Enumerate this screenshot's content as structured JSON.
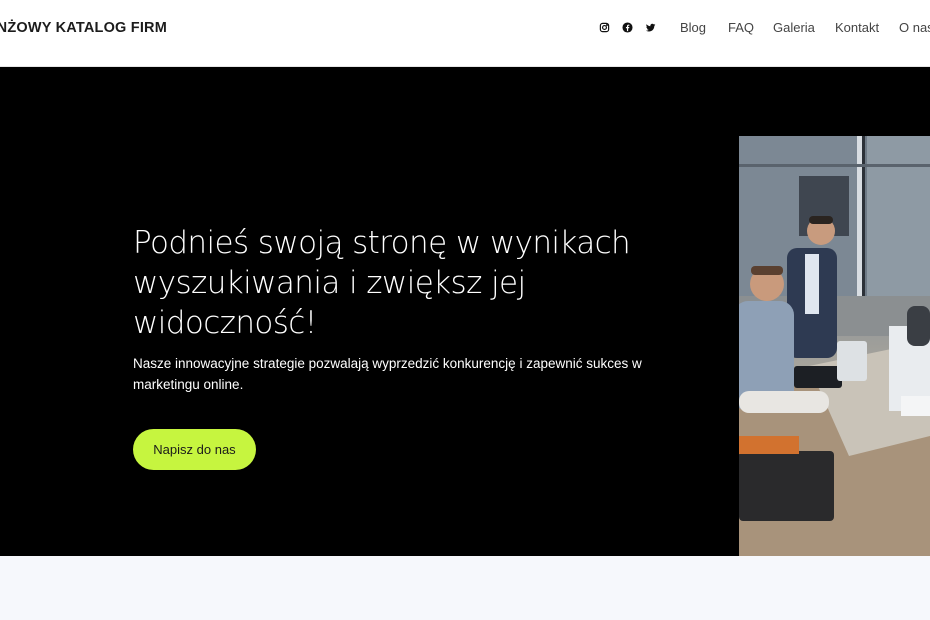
{
  "header": {
    "logo": "ANŻOWY KATALOG FIRM",
    "social": [
      {
        "name": "instagram-icon"
      },
      {
        "name": "facebook-icon"
      },
      {
        "name": "twitter-icon"
      }
    ],
    "nav": [
      "Blog",
      "FAQ",
      "Galeria",
      "Kontakt",
      "O nas"
    ]
  },
  "hero": {
    "title": "Podnieś swoją stronę w wynikach wyszukiwania i zwiększ jej widoczność!",
    "subtitle": "Nasze innowacyjne strategie pozwalają wyprzedzić konkurencję i zapewnić sukces w marketingu online.",
    "cta_label": "Napisz do nas"
  },
  "colors": {
    "hero_bg": "#000000",
    "cta_bg": "#c6f53f",
    "below_bg": "#f6f8fc"
  }
}
